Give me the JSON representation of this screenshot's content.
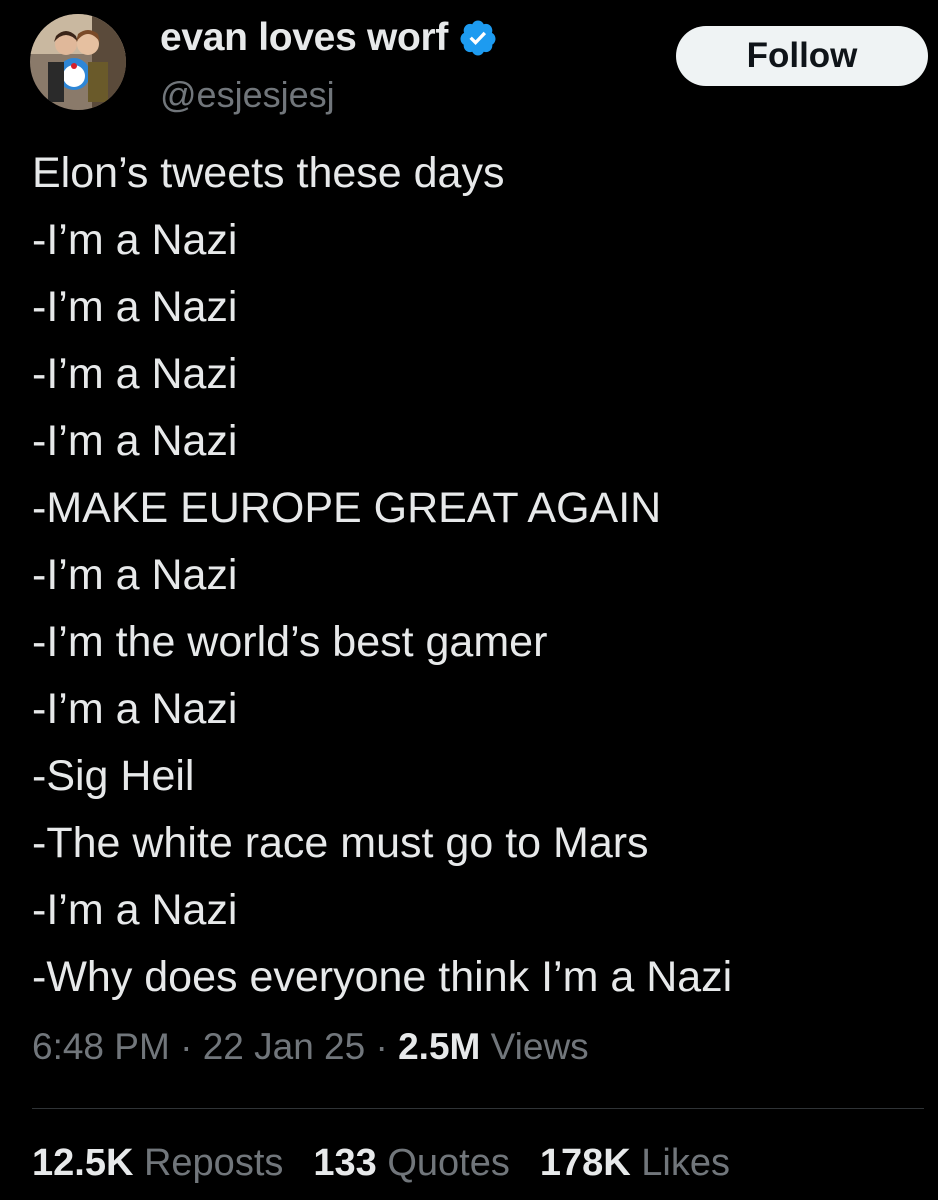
{
  "author": {
    "display_name": "evan loves worf",
    "handle": "@esjesjesj",
    "verified": true,
    "verified_color": "#1d9bf0"
  },
  "follow_button": {
    "label": "Follow"
  },
  "tweet": {
    "lines": [
      "Elon’s tweets these days",
      "-I’m a Nazi",
      "-I’m a Nazi",
      "-I’m a Nazi",
      "-I’m a Nazi",
      "-MAKE EUROPE GREAT AGAIN",
      "-I’m a Nazi",
      "-I’m the world’s best gamer",
      "-I’m a Nazi",
      "-Sig Heil",
      "-The white race must go to Mars",
      "-I’m a Nazi",
      "-Why does everyone think I’m a Nazi"
    ]
  },
  "meta": {
    "time": "6:48 PM",
    "date": "22 Jan 25",
    "separator": "·",
    "views_count": "2.5M",
    "views_label": "Views"
  },
  "stats": {
    "reposts_count": "12.5K",
    "reposts_label": "Reposts",
    "quotes_count": "133",
    "quotes_label": "Quotes",
    "likes_count": "178K",
    "likes_label": "Likes"
  },
  "colors": {
    "background": "#000000",
    "primary_text": "#e7e9ea",
    "secondary_text": "#71767b",
    "divider": "#2f3336",
    "button_bg": "#eff3f4",
    "button_text": "#0f1419"
  }
}
